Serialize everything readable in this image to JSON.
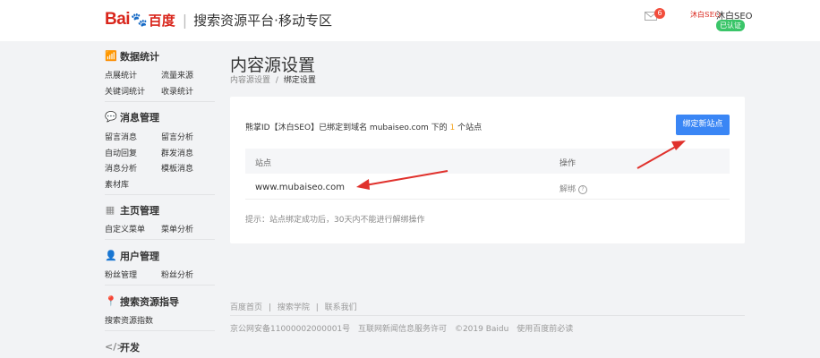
{
  "header": {
    "logo_bai": "Bai",
    "logo_du": "百度",
    "separator": "|",
    "platform_title": "搜索资源平台·移动专区",
    "mail_icon": "mail-icon",
    "mail_count": "6",
    "avatar_text": "沐白SEO",
    "username": "沐白SEO",
    "verified_label": "已认证"
  },
  "sidebar": {
    "sections": [
      {
        "title": "数据统计",
        "icon": "chart-icon",
        "items": [
          "点展统计",
          "流量来源",
          "关键词统计",
          "收录统计"
        ]
      },
      {
        "title": "消息管理",
        "icon": "message-icon",
        "items": [
          "留言消息",
          "留言分析",
          "自动回复",
          "群发消息",
          "消息分析",
          "模板消息",
          "素材库"
        ]
      },
      {
        "title": "主页管理",
        "icon": "grid-icon",
        "items": [
          "自定义菜单",
          "菜单分析"
        ]
      },
      {
        "title": "用户管理",
        "icon": "user-icon",
        "items": [
          "粉丝管理",
          "粉丝分析"
        ]
      },
      {
        "title": "搜索资源指导",
        "icon": "location-icon",
        "items": [
          "搜索资源指数"
        ]
      },
      {
        "title": "开发",
        "icon": "code-icon",
        "items": []
      }
    ]
  },
  "main": {
    "page_title": "内容源设置",
    "breadcrumb": {
      "parent": "内容源设置",
      "sep": "/",
      "current": "绑定设置"
    },
    "info": {
      "prefix": "熊掌ID【沐白SEO】已绑定到域名 mubaiseo.com 下的",
      "count": "1",
      "suffix": "个站点"
    },
    "bind_button": "绑定新站点",
    "table": {
      "headers": [
        "站点",
        "操作"
      ],
      "rows": [
        {
          "site": "www.mubaiseo.com",
          "action": "解绑",
          "help": "?"
        }
      ]
    },
    "tip": "提示：站点绑定成功后，30天内不能进行解绑操作"
  },
  "footer": {
    "links": [
      "百度首页",
      "|",
      "搜索学院",
      "|",
      "联系我们"
    ],
    "copyright": [
      "京公网安备11000002000001号",
      "互联网新闻信息服务许可",
      "©2019 Baidu",
      "使用百度前必读"
    ]
  },
  "colors": {
    "accent": "#3a86f5",
    "brand_red": "#d9261c",
    "verified_green": "#3ac569",
    "annotation_red": "#e0312c"
  }
}
